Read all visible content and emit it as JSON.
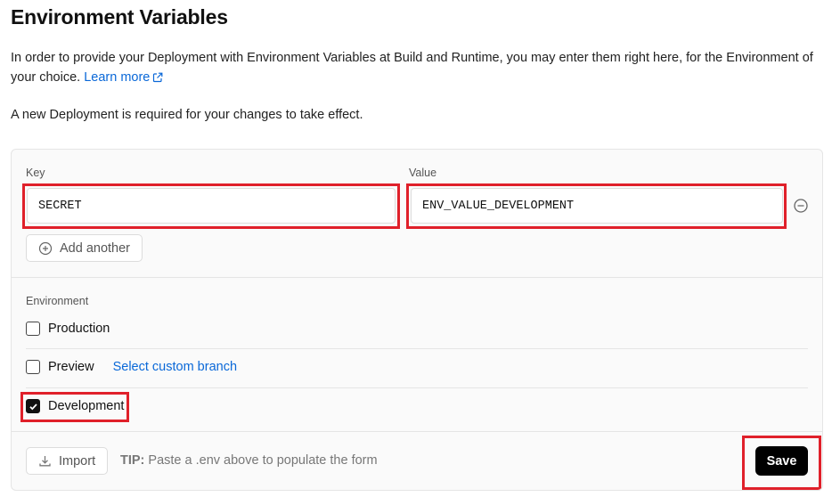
{
  "page": {
    "title": "Environment Variables",
    "description": "In order to provide your Deployment with Environment Variables at Build and Runtime, you may enter them right here, for the Environment of your choice.",
    "learn_more": "Learn more",
    "note": "A new Deployment is required for your changes to take effect."
  },
  "form": {
    "key_label": "Key",
    "value_label": "Value",
    "key_value": "SECRET",
    "value_value": "ENV_VALUE_DEVELOPMENT",
    "add_another": "Add another",
    "environment_label": "Environment",
    "environments": [
      {
        "label": "Production",
        "checked": false
      },
      {
        "label": "Preview",
        "checked": false,
        "link": "Select custom branch"
      },
      {
        "label": "Development",
        "checked": true
      }
    ],
    "import_label": "Import",
    "tip_prefix": "TIP:",
    "tip_text": "Paste a .env above to populate the form",
    "save_label": "Save"
  },
  "colors": {
    "link": "#0a68d8",
    "highlight": "#e0202a",
    "primary_button": "#000000"
  },
  "icons": [
    "external-link-icon",
    "remove-circle-icon",
    "plus-circle-icon",
    "checkmark-icon",
    "download-icon"
  ]
}
